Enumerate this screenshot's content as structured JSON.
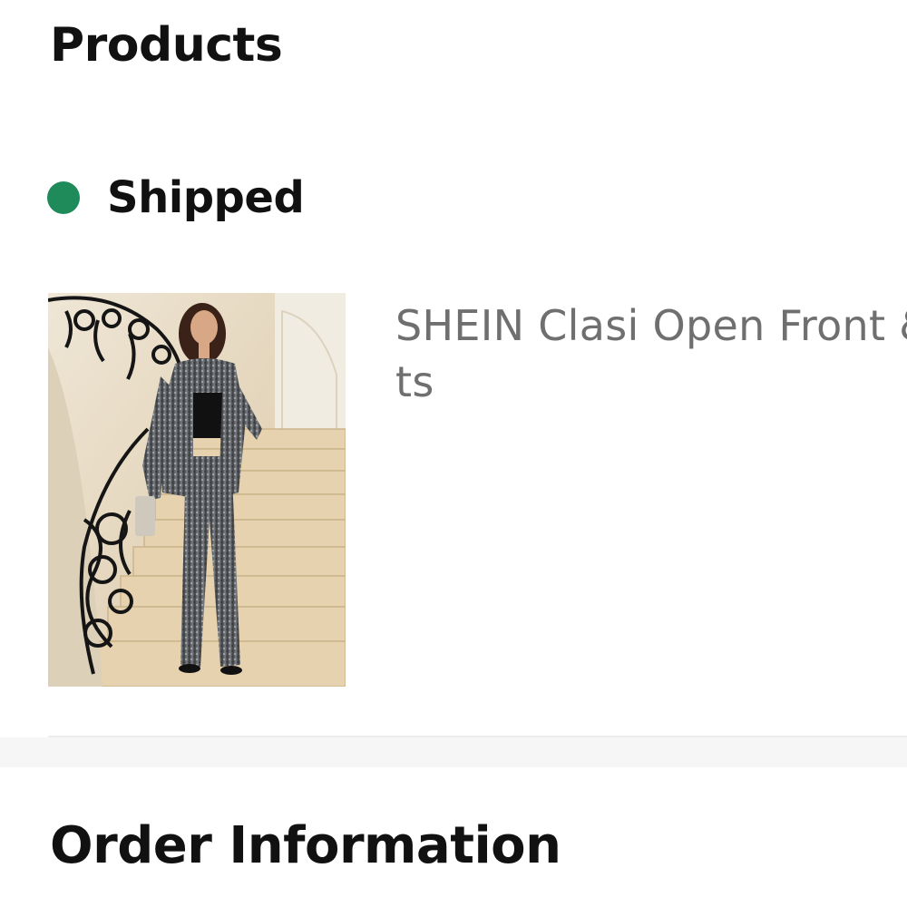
{
  "products_section": {
    "title": "Products"
  },
  "shipment": {
    "status_label": "Shipped",
    "status_color": "#1f8a5a"
  },
  "product": {
    "name": "SHEIN Clasi Open Front & Pants",
    "image_alt": "Woman in sequin blazer and pants on staircase"
  },
  "order_section": {
    "title": "Order Information"
  }
}
